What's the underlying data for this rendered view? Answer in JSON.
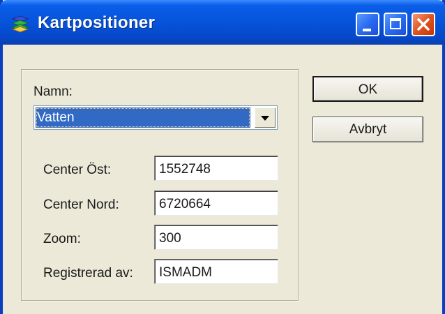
{
  "window": {
    "title": "Kartpositioner"
  },
  "icons": {
    "app": "app-layers-icon",
    "minimize": "minimize-icon",
    "maximize": "maximize-icon",
    "close": "close-icon",
    "dropdown": "chevron-down-icon"
  },
  "colors": {
    "titlebar": "#0653da",
    "selection": "#316ac5",
    "close_button": "#e0531f",
    "face": "#ece9d8"
  },
  "form": {
    "name_label": "Namn:",
    "name_value": "Vatten",
    "fields": [
      {
        "label": "Center Öst:",
        "value": "1552748"
      },
      {
        "label": "Center Nord:",
        "value": "6720664"
      },
      {
        "label": "Zoom:",
        "value": "300"
      },
      {
        "label": "Registrerad av:",
        "value": "ISMADM"
      }
    ]
  },
  "buttons": {
    "ok": "OK",
    "cancel": "Avbryt"
  }
}
